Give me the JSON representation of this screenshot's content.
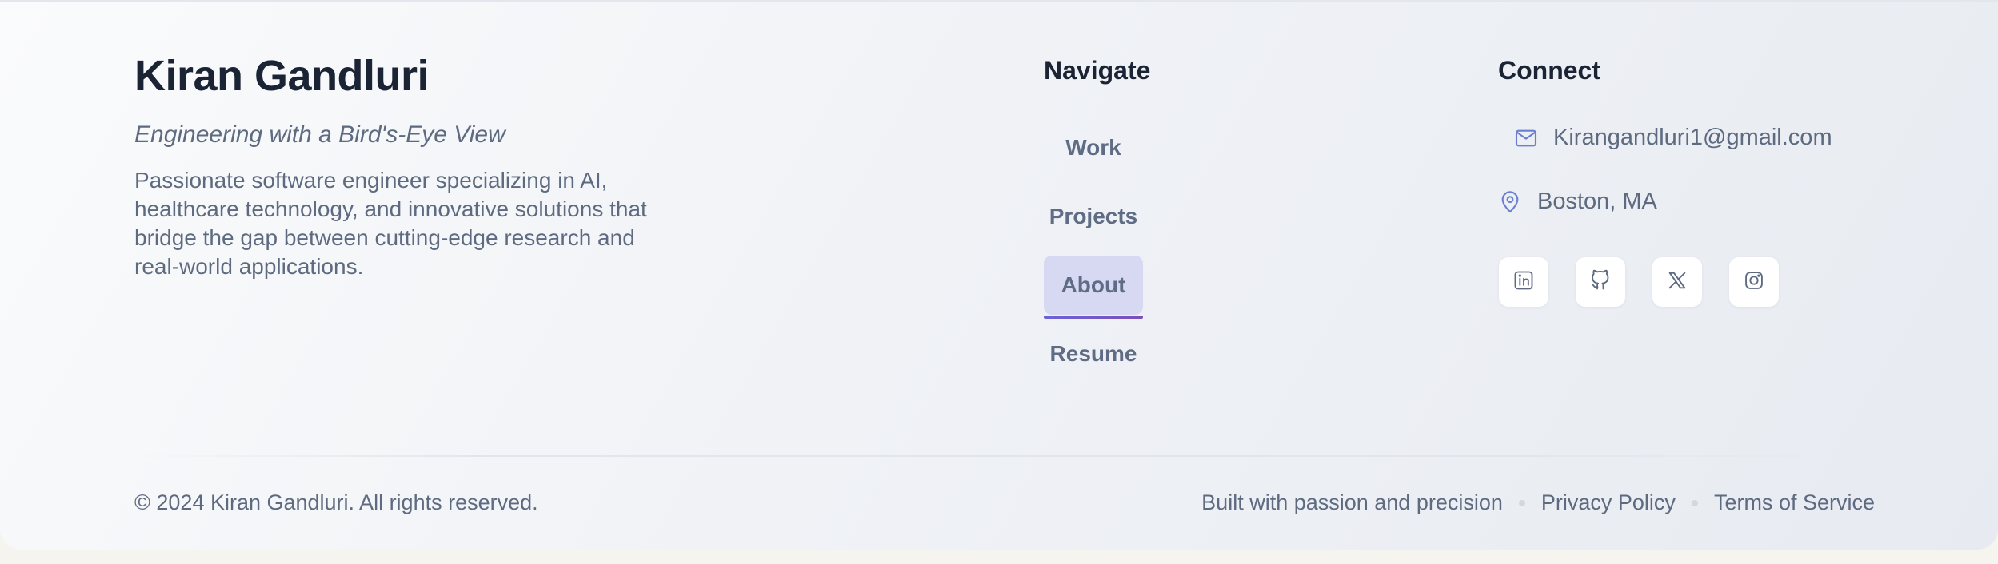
{
  "brand": {
    "name": "Kiran Gandluri",
    "tagline": "Engineering with a Bird's-Eye View",
    "description": "Passionate software engineer specializing in AI, healthcare technology, and innovative solutions that bridge the gap between cutting-edge research and real-world applications."
  },
  "navigate": {
    "heading": "Navigate",
    "items": [
      {
        "label": "Work",
        "active": false
      },
      {
        "label": "Projects",
        "active": false
      },
      {
        "label": "About",
        "active": true
      },
      {
        "label": "Resume",
        "active": false
      }
    ]
  },
  "connect": {
    "heading": "Connect",
    "email": {
      "icon": "mail-icon",
      "text": "Kirangandluri1@gmail.com"
    },
    "location": {
      "icon": "map-pin-icon",
      "text": "Boston, MA"
    },
    "socials": [
      {
        "icon": "linkedin-icon"
      },
      {
        "icon": "github-icon"
      },
      {
        "icon": "x-twitter-icon"
      },
      {
        "icon": "instagram-icon"
      }
    ]
  },
  "bottom": {
    "copyright": "© 2024 Kiran Gandluri. All rights reserved.",
    "tagline": "Built with passion and precision",
    "privacy": "Privacy Policy",
    "terms": "Terms of Service"
  },
  "colors": {
    "heading": "#1b2434",
    "text": "#5d6a80",
    "icon_accent": "#6b7fd0",
    "active_bg": "#d6d9f1",
    "active_underline": "#6c63d8"
  }
}
